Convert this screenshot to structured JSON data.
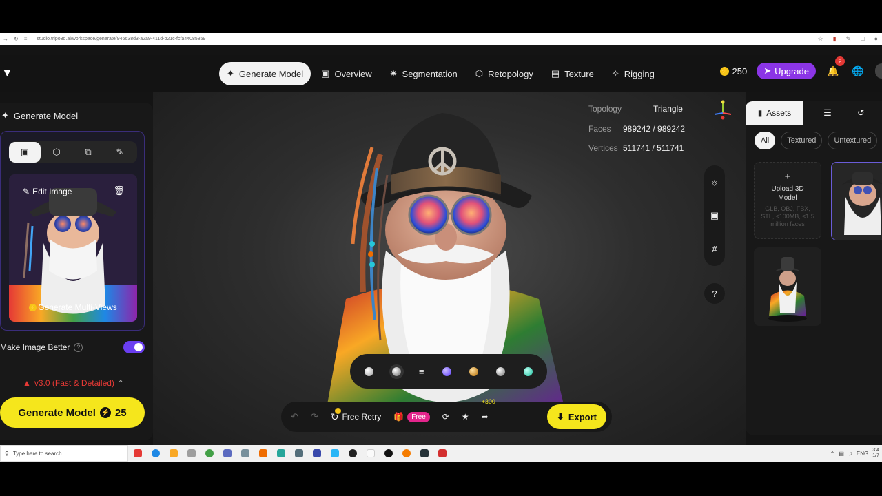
{
  "browser": {
    "url": "studio.tripo3d.ai/workspace/generate/946638d3-a2a9-411d-b21c-fcfa44085859",
    "nav_icons": [
      "back-icon",
      "forward-icon",
      "reload-icon"
    ],
    "right_icons": [
      "star-icon",
      "extension-icon",
      "download-icon",
      "profile-icon"
    ]
  },
  "nav": {
    "logo_icon": "tripo-logo",
    "tabs": [
      {
        "label": "Generate Model",
        "icon": "sparkle-icon",
        "active": true
      },
      {
        "label": "Overview",
        "icon": "overview-icon"
      },
      {
        "label": "Segmentation",
        "icon": "segmentation-icon"
      },
      {
        "label": "Retopology",
        "icon": "retopology-icon"
      },
      {
        "label": "Texture",
        "icon": "texture-icon"
      },
      {
        "label": "Rigging",
        "icon": "rigging-icon"
      }
    ],
    "credits": "250",
    "upgrade_label": "Upgrade",
    "notification_count": "2"
  },
  "left_panel": {
    "title": "Generate Model",
    "mode_tabs": [
      "image-mode-icon",
      "model-mode-icon",
      "multi-image-icon",
      "pen-icon"
    ],
    "edit_image_label": "Edit Image",
    "multi_views_label": "Generate Multi-Views",
    "make_better_label": "Make Image Better",
    "make_better_enabled": true,
    "version_label": "v3.0 (Fast & Detailed)",
    "generate_label": "Generate Model",
    "generate_cost": "25"
  },
  "viewport": {
    "stats": [
      {
        "label": "Topology",
        "value": "Triangle"
      },
      {
        "label": "Faces",
        "value": "989242 / 989242"
      },
      {
        "label": "Vertices",
        "value": "511741 / 511741"
      }
    ],
    "side_tools": [
      "light-icon",
      "camera-icon",
      "grid-icon"
    ],
    "help_label": "?",
    "materials": [
      "#e8e8e8",
      "#bdbdbd",
      "#7b5cff",
      "#d99a2b",
      "#a0a0a0",
      "#3fd4b4"
    ],
    "bottom_bar": {
      "free_retry_label": "Free Retry",
      "free_badge": "Free",
      "share_bonus": "+300",
      "export_label": "Export"
    }
  },
  "assets": {
    "tab_label": "Assets",
    "filters": [
      "All",
      "Textured",
      "Untextured"
    ],
    "active_filter": "All",
    "upload_title": "Upload 3D Model",
    "upload_formats": "GLB, OBJ, FBX, STL, ≤100MB, ≤1.5 million faces"
  },
  "taskbar": {
    "search_placeholder": "Type here to search",
    "lang": "ENG",
    "time": "3:4",
    "date": "1/7"
  }
}
